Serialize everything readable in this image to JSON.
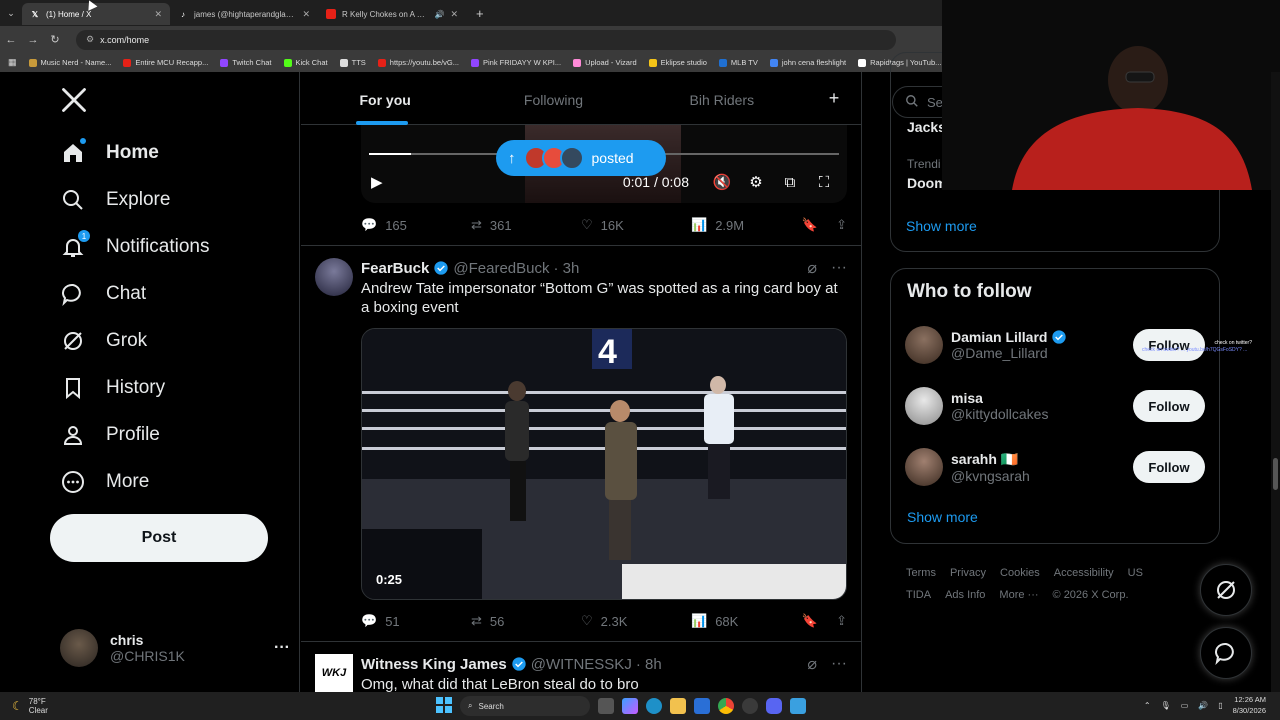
{
  "browser": {
    "tabs": [
      {
        "title": "(1) Home / X",
        "active": true,
        "favicon": "x-favicon"
      },
      {
        "title": "james (@hightaperandglasses)",
        "active": false,
        "favicon": "tiktok-favicon"
      },
      {
        "title": "R Kelly Chokes on A Huge",
        "active": false,
        "favicon": "youtube-favicon"
      }
    ],
    "new_tab_label": "+",
    "url": "x.com/home",
    "bookmarks": [
      {
        "label": "Music Nerd - Name...",
        "color": "#c89a3a"
      },
      {
        "label": "Entire MCU Recapp...",
        "color": "#e62117"
      },
      {
        "label": "Twitch Chat",
        "color": "#9146ff"
      },
      {
        "label": "Kick Chat",
        "color": "#53fc18"
      },
      {
        "label": "TTS",
        "color": "#dddddd"
      },
      {
        "label": "https://youtu.be/vG...",
        "color": "#e62117"
      },
      {
        "label": "Pink FRIDAYY W KPI...",
        "color": "#9146ff"
      },
      {
        "label": "Upload - Vizard",
        "color": "#ff8ad8"
      },
      {
        "label": "Eklipse studio",
        "color": "#f5c518"
      },
      {
        "label": "MLB TV",
        "color": "#1f6fd1"
      },
      {
        "label": "john cena fleshlight",
        "color": "#4285f4"
      },
      {
        "label": "Rapidtags | YouTub...",
        "color": "#ffffff"
      }
    ]
  },
  "nav": {
    "items": [
      {
        "label": "Home",
        "icon": "home-icon",
        "bold": true
      },
      {
        "label": "Explore",
        "icon": "search-icon"
      },
      {
        "label": "Notifications",
        "icon": "bell-icon",
        "badge": "1"
      },
      {
        "label": "Chat",
        "icon": "chat-icon"
      },
      {
        "label": "Grok",
        "icon": "grok-icon"
      },
      {
        "label": "History",
        "icon": "bookmark-icon"
      },
      {
        "label": "Profile",
        "icon": "person-icon"
      },
      {
        "label": "More",
        "icon": "more-circle-icon"
      }
    ],
    "post_label": "Post",
    "account": {
      "name": "chris",
      "handle": "@CHRIS1K",
      "menu": "···"
    }
  },
  "feed": {
    "tabs": [
      "For you",
      "Following",
      "Bih Riders"
    ],
    "add_tab": "+",
    "video1": {
      "time": "0:01 / 0:08",
      "progress": 0.09
    },
    "posted_pill": "posted",
    "tweet1_stats": {
      "replies": "165",
      "reposts": "361",
      "likes": "16K",
      "views": "2.9M"
    },
    "tweet2": {
      "name": "FearBuck",
      "handle": "@FearedBuck",
      "time": "· 3h",
      "text": "Andrew Tate impersonator “Bottom G” was spotted as a ring card boy at a boxing event",
      "video_duration": "0:25",
      "video_card_number": "4",
      "stats": {
        "replies": "51",
        "reposts": "56",
        "likes": "2.3K",
        "views": "68K"
      }
    },
    "tweet3": {
      "name": "Witness King James",
      "handle": "@WITNESSKJ",
      "time": "· 8h",
      "text": "Omg, what did that LeBron steal do to bro",
      "avatar_text": "WKJ"
    }
  },
  "sidebar": {
    "search_placeholder": "Sea",
    "trend_cut_top": "Jacks",
    "trend_label": "Trendi",
    "trend_name": "Doom",
    "show_more": "Show more",
    "who_to_follow_title": "Who to follow",
    "follow_suggestions": [
      {
        "name": "Damian Lillard",
        "handle": "@Dame_Lillard",
        "verified": true,
        "button": "Follow",
        "avatar_color": "#5a4a3a"
      },
      {
        "name": "misa",
        "handle": "@kittydollcakes",
        "verified": false,
        "button": "Follow",
        "avatar_color": "#d8d8d8"
      },
      {
        "name": "sarahh 🇮🇪",
        "handle": "@kvngsarah",
        "verified": false,
        "button": "Follow",
        "avatar_color": "#6a5040"
      }
    ],
    "show_more_2": "Show more",
    "footer_links": [
      "Terms",
      "Privacy",
      "Cookies",
      "Accessibility",
      "US TIDA",
      "Ads Info",
      "More ···",
      "© 2026 X Corp."
    ]
  },
  "overlay": {
    "text": "check on twitter? ... youtu.be/h7QGsFoSDY? ...",
    "first_line": "check on twitter?"
  },
  "taskbar": {
    "weather_temp": "78°F",
    "weather_desc": "Clear",
    "search_label": "Search",
    "time": "12:26 AM",
    "date": "8/30/2026"
  },
  "colors": {
    "accent": "#1d9bf0",
    "background": "#000000",
    "border": "#2f3336",
    "muted": "#71767b"
  }
}
